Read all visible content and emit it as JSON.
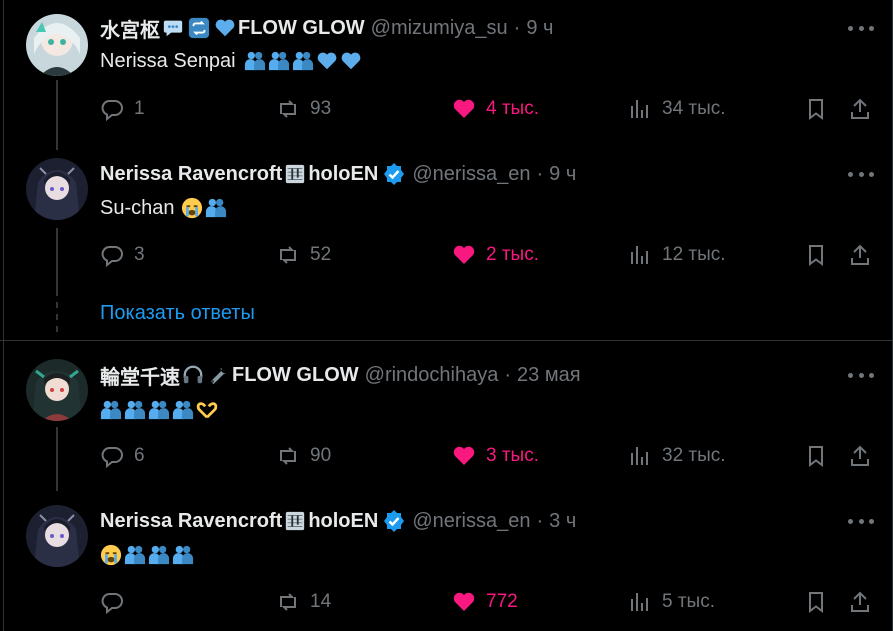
{
  "colors": {
    "background": "#000000",
    "text": "#e7e9ea",
    "muted": "#71767b",
    "like": "#f91880",
    "link": "#1d9bf0",
    "verified": "#1d9bf0"
  },
  "tweets": [
    {
      "display_name": "水宮枢",
      "name_suffix": "FLOW GLOW",
      "handle": "@mizumiya_su",
      "time": "9 ч",
      "text": "Nerissa Senpai",
      "name_icons": [
        "speech-bubble-icon",
        "repeat-icon",
        "blue-heart-icon"
      ],
      "body_emojis": [
        "people-hugging-icon",
        "people-hugging-icon",
        "people-hugging-icon",
        "blue-heart-icon",
        "blue-heart-icon"
      ],
      "stats": {
        "replies": "1",
        "reposts": "93",
        "likes": "4 тыс.",
        "views": "34 тыс."
      }
    },
    {
      "display_name": "Nerissa Ravencroft",
      "name_suffix": "holoEN",
      "handle": "@nerissa_en",
      "time": "9 ч",
      "text": "Su-chan",
      "verified": true,
      "name_icons": [
        "sheet-music-icon"
      ],
      "body_emojis": [
        "loudly-crying-face-icon",
        "people-hugging-icon"
      ],
      "stats": {
        "replies": "3",
        "reposts": "52",
        "likes": "2 тыс.",
        "views": "12 тыс."
      }
    },
    {
      "display_name": "輪堂千速",
      "name_suffix": "FLOW GLOW",
      "handle": "@rindochihaya",
      "time": "23 мая",
      "text": "",
      "name_icons": [
        "headphone-icon",
        "wrench-icon"
      ],
      "body_emojis": [
        "people-hugging-icon",
        "people-hugging-icon",
        "people-hugging-icon",
        "people-hugging-icon",
        "heart-hands-icon"
      ],
      "stats": {
        "replies": "6",
        "reposts": "90",
        "likes": "3 тыс.",
        "views": "32 тыс."
      }
    },
    {
      "display_name": "Nerissa Ravencroft",
      "name_suffix": "holoEN",
      "handle": "@nerissa_en",
      "time": "3 ч",
      "text": "",
      "verified": true,
      "name_icons": [
        "sheet-music-icon"
      ],
      "body_emojis": [
        "loudly-crying-face-icon",
        "people-hugging-icon",
        "people-hugging-icon",
        "people-hugging-icon"
      ],
      "stats": {
        "replies": "",
        "reposts": "14",
        "likes": "772",
        "views": "5 тыс."
      }
    }
  ],
  "show_replies_label": "Показать ответы",
  "dot_separator": "·"
}
